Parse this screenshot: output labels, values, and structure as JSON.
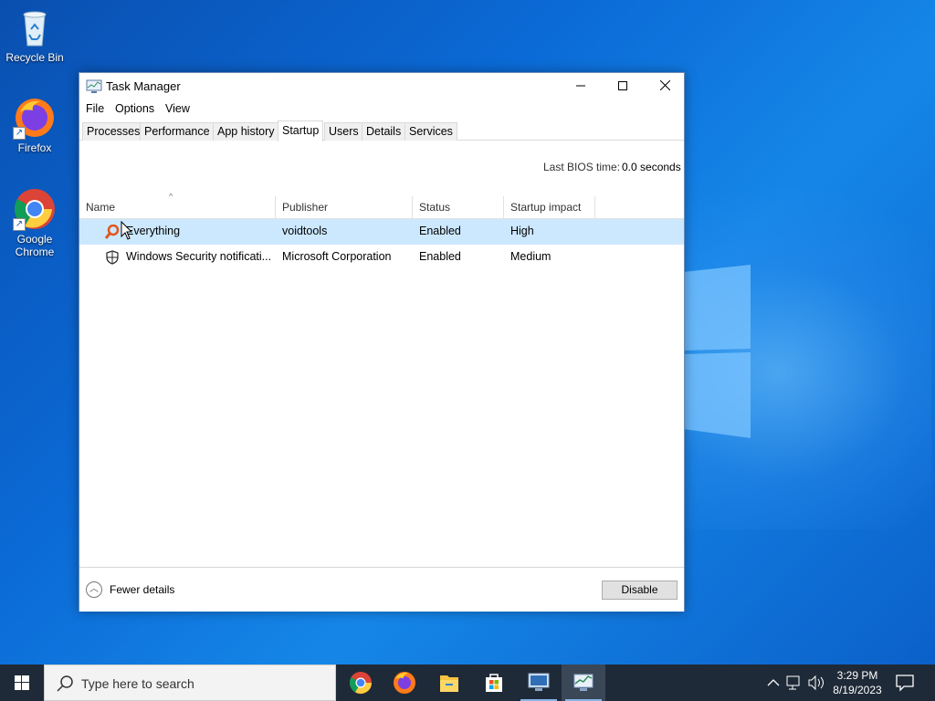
{
  "desktop": {
    "icons": [
      {
        "label": "Recycle Bin"
      },
      {
        "label": "Firefox"
      },
      {
        "label": "Google Chrome"
      }
    ]
  },
  "window": {
    "title": "Task Manager",
    "menu": [
      "File",
      "Options",
      "View"
    ],
    "tabs": [
      "Processes",
      "Performance",
      "App history",
      "Startup",
      "Users",
      "Details",
      "Services"
    ],
    "active_tab": "Startup",
    "bios_label": "Last BIOS time:",
    "bios_value": "0.0 seconds",
    "columns": [
      "Name",
      "Publisher",
      "Status",
      "Startup impact"
    ],
    "rows": [
      {
        "name": "Everything",
        "publisher": "voidtools",
        "status": "Enabled",
        "impact": "High",
        "icon": "everything-icon",
        "selected": true
      },
      {
        "name": "Windows Security notificati...",
        "publisher": "Microsoft Corporation",
        "status": "Enabled",
        "impact": "Medium",
        "icon": "shield-icon",
        "selected": false
      }
    ],
    "fewer_details": "Fewer details",
    "disable_button": "Disable"
  },
  "taskbar": {
    "search_placeholder": "Type here to search",
    "apps": [
      "chrome-icon",
      "firefox-icon",
      "file-explorer-icon",
      "store-icon",
      "remote-desktop-icon",
      "task-manager-icon"
    ],
    "time": "3:29 PM",
    "date": "8/19/2023"
  },
  "colors": {
    "selection": "#cce8ff",
    "taskbar": "#1f2a38",
    "desktop": "#0b6ad6"
  }
}
